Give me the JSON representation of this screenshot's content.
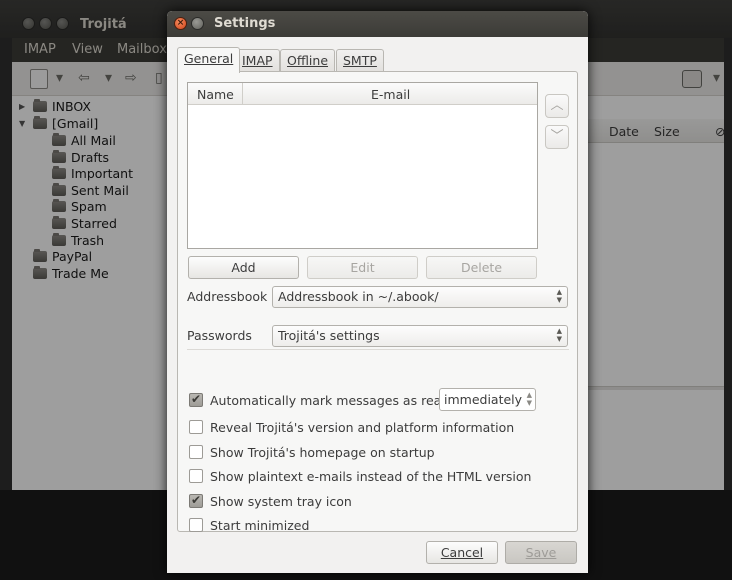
{
  "main_window": {
    "title": "Trojitá",
    "menu": [
      "IMAP",
      "View",
      "Mailbox"
    ],
    "folders": [
      "INBOX",
      "[Gmail]",
      "All Mail",
      "Drafts",
      "Important",
      "Sent Mail",
      "Spam",
      "Starred",
      "Trash",
      "PayPal",
      "Trade Me"
    ],
    "columns": {
      "date": "Date",
      "size": "Size"
    }
  },
  "dialog": {
    "title": "Settings",
    "tabs": [
      "General",
      "IMAP",
      "Offline",
      "SMTP"
    ],
    "identities": {
      "col_name": "Name",
      "col_email": "E-mail",
      "up_arrow": "︿",
      "down_arrow": "﹀",
      "add_label": "Add",
      "edit_label": "Edit",
      "delete_label": "Delete"
    },
    "addressbook": {
      "label": "Addressbook",
      "value": "Addressbook in ~/.abook/"
    },
    "passwords": {
      "label": "Passwords",
      "value": "Trojitá's settings"
    },
    "options": {
      "auto_mark": {
        "label": "Automatically mark messages as read",
        "checked": true,
        "interval": "immediately"
      },
      "reveal_version": {
        "label": "Reveal Trojitá's version and platform information",
        "checked": false
      },
      "show_homepage": {
        "label": "Show Trojitá's homepage on startup",
        "checked": false
      },
      "plaintext": {
        "label": "Show plaintext e-mails instead of the HTML version",
        "checked": false
      },
      "tray_icon": {
        "label": "Show system tray icon",
        "checked": true
      },
      "start_min": {
        "label": "Start minimized",
        "checked": false
      }
    },
    "cancel_label": "Cancel",
    "save_label": "Save"
  }
}
